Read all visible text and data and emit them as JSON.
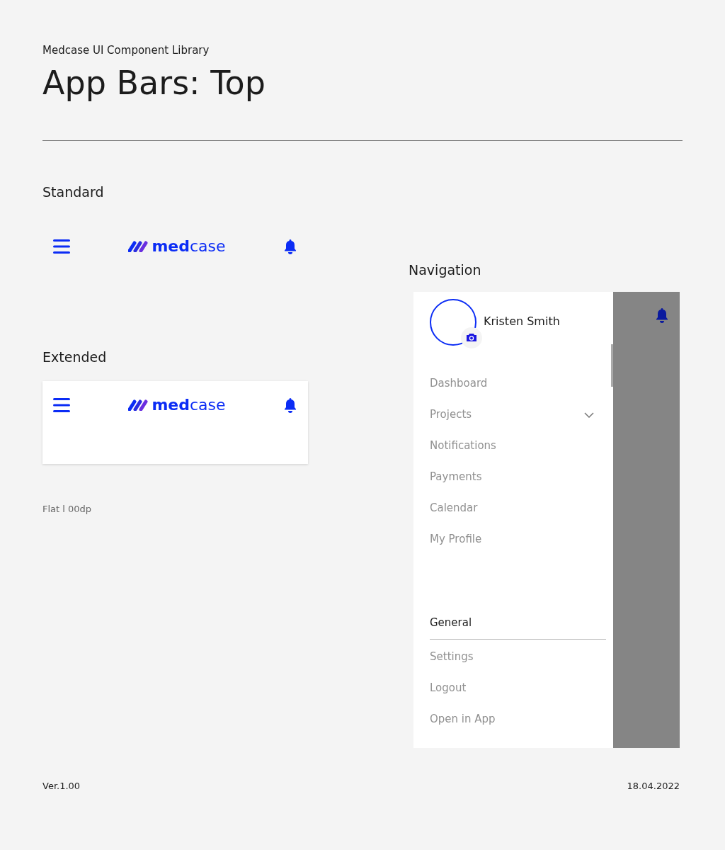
{
  "header": {
    "subtitle": "Medcase UI Component Library",
    "title": "App Bars: Top"
  },
  "standard": {
    "heading": "Standard",
    "logo": "**med**case"
  },
  "extended": {
    "heading": "Extended",
    "logo": "**med**case",
    "caption": "Flat l 00dp"
  },
  "navigation": {
    "heading": "Navigation",
    "user": "Kristen Smith",
    "items": [
      {
        "label": "Dashboard"
      },
      {
        "label": "Projects",
        "expanded": false
      },
      {
        "label": "Notifications"
      },
      {
        "label": "Payments"
      },
      {
        "label": "Calendar"
      },
      {
        "label": "My Profile"
      }
    ],
    "section": "General",
    "section_items": [
      "Settings",
      "Logout",
      "Open in App"
    ]
  },
  "footer": {
    "version": "Ver.1.00",
    "date": "18.04.2022"
  }
}
